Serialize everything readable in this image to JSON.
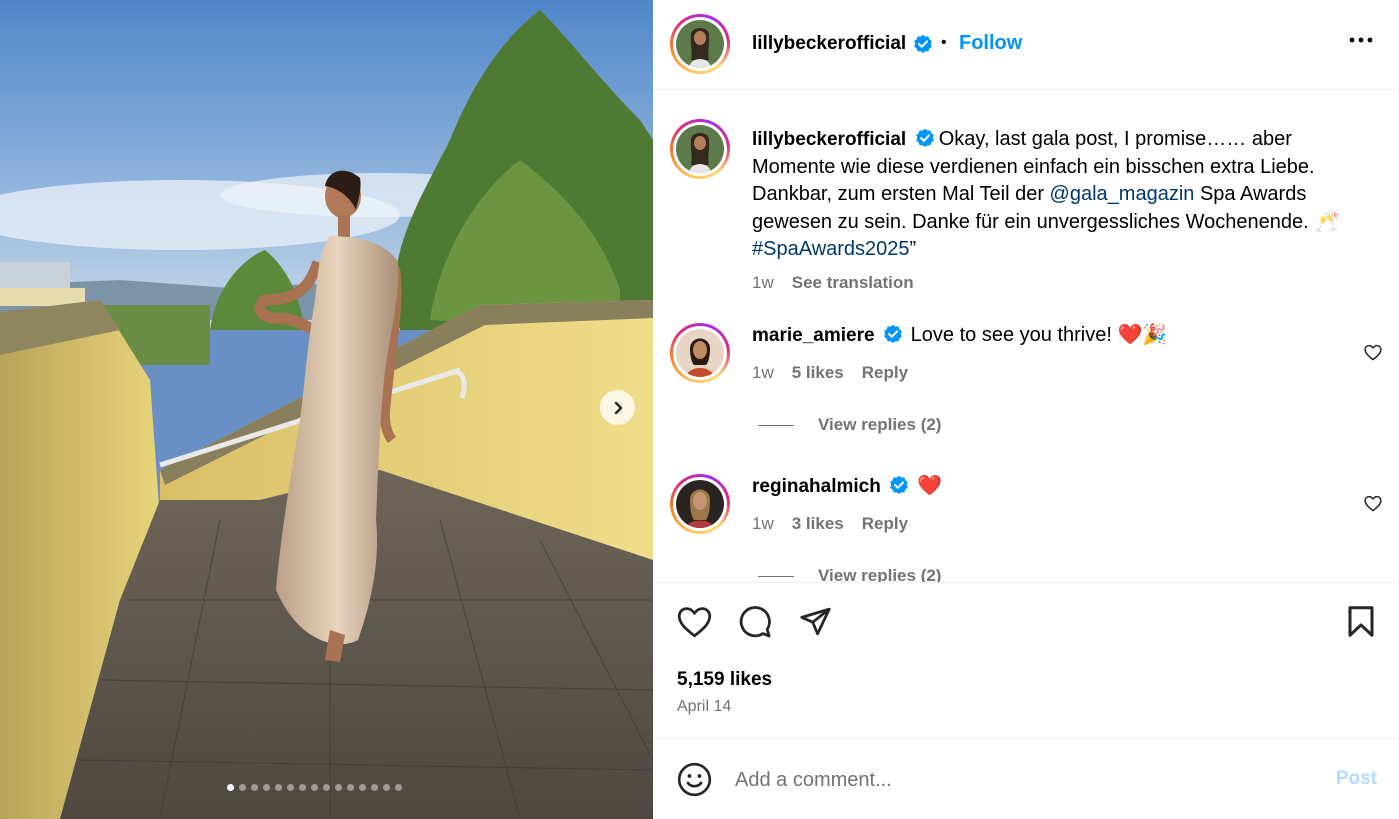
{
  "post": {
    "username": "lillybeckerofficial",
    "follow_label": "Follow",
    "separator": "•",
    "carousel": {
      "slides": 15,
      "active_index": 0
    }
  },
  "caption": {
    "username": "lillybeckerofficial",
    "text_1": "Okay, last gala post, I promise…… aber Momente wie diese verdienen einfach ein bisschen extra Liebe. Dankbar, zum ersten Mal Teil der ",
    "mention": "@gala_magazin",
    "text_2": " Spa Awards gewesen zu sein. Danke für ein unvergessliches Wochenende. ",
    "emoji": "🥂",
    "hashtag": "#SpaAwards2025",
    "text_3": "”",
    "time": "1w",
    "translation": "See translation"
  },
  "comments": [
    {
      "username": "marie_amiere",
      "text": "Love to see you thrive! ❤️🎉",
      "time": "1w",
      "likes": "5 likes",
      "reply": "Reply",
      "view_replies": "View replies (2)"
    },
    {
      "username": "reginahalmich",
      "text": "❤️",
      "time": "1w",
      "likes": "3 likes",
      "reply": "Reply",
      "view_replies": "View replies (2)"
    }
  ],
  "stats": {
    "likes": "5,159 likes",
    "date": "April 14"
  },
  "composer": {
    "placeholder": "Add a comment...",
    "post_label": "Post"
  },
  "icons": {
    "verified": "verified-badge-icon",
    "more": "more-options-icon",
    "like": "heart-icon",
    "comment": "comment-icon",
    "share": "share-icon",
    "save": "bookmark-icon",
    "emoji": "emoji-icon",
    "next": "chevron-right-icon"
  },
  "colors": {
    "accent": "#0095f6",
    "verified": "#0095f6",
    "link": "#00376b",
    "muted": "#737373",
    "post_disabled": "#b3dbff"
  }
}
